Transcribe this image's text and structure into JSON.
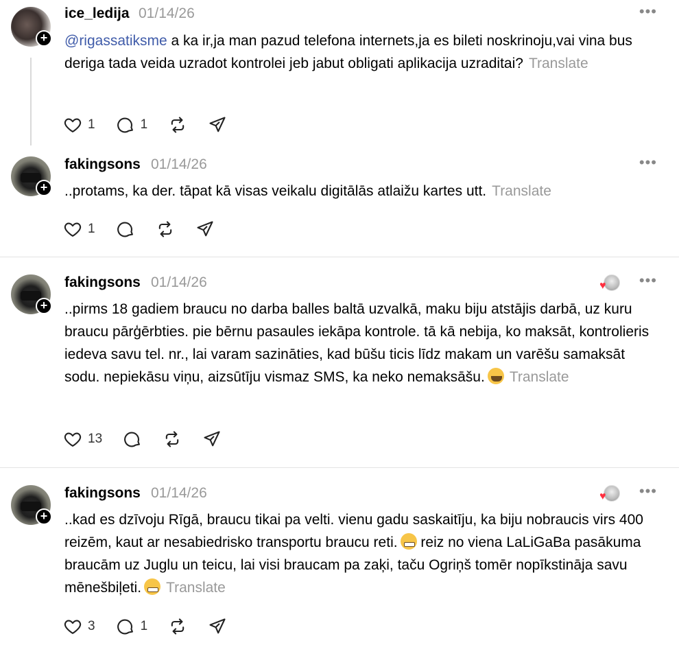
{
  "posts": [
    {
      "username": "ice_ledija",
      "time": "01/14/26",
      "mention": "@rigassatiksme",
      "text": " a ka ir,ja man pazud telefona internets,ja es bileti noskrinoju,vai vina bus deriga tada veida uzradot kontrolei jeb jabut obligati aplikacija uzraditai?",
      "translate": "Translate",
      "likes": "1",
      "replies": "1",
      "reposts": "",
      "avatar_icon": "user-avatar"
    },
    {
      "username": "fakingsons",
      "time": "01/14/26",
      "text": "..protams, ka der. tāpat kā visas veikalu digitālās atlaižu kartes utt.",
      "translate": "Translate",
      "likes": "1",
      "replies": "",
      "reposts": ""
    },
    {
      "username": "fakingsons",
      "time": "01/14/26",
      "text": "..pirms 18 gadiem braucu no darba balles baltā uzvalkā, maku biju atstājis darbā, uz kuru braucu pārģērbties. pie bērnu pasaules iekāpa kontrole. tā kā nebija, ko maksāt, kontrolieris iedeva savu tel. nr., lai varam sazināties, kad būšu ticis līdz makam un varēšu samaksāt sodu. nepiekāsu viņu, aizsūtīju vismaz SMS, ka neko nemaksāšu.",
      "emoji": "nerd-face-emoji",
      "translate": "Translate",
      "likes": "13",
      "replies": "",
      "reposts": ""
    },
    {
      "username": "fakingsons",
      "time": "01/14/26",
      "text_part1": "..kad es dzīvoju Rīgā, braucu tikai pa velti. vienu gadu saskaitīju, ka biju nobraucis virs 400 reizēm, kaut ar nesabiedrisko transportu braucu reti.",
      "text_part2": " reiz no viena LaLiGaBa pasākuma braucām uz Juglu un teicu, lai visi braucam pa zaķi, taču Ogriņš tomēr nopīkstināja savu mēnešbiļeti.",
      "emoji": "grinning-face-emoji",
      "translate": "Translate",
      "likes": "3",
      "replies": "1",
      "reposts": ""
    }
  ],
  "colors": {
    "mention": "#3f5ba9",
    "muted": "#999999",
    "heart": "#ff3040"
  }
}
